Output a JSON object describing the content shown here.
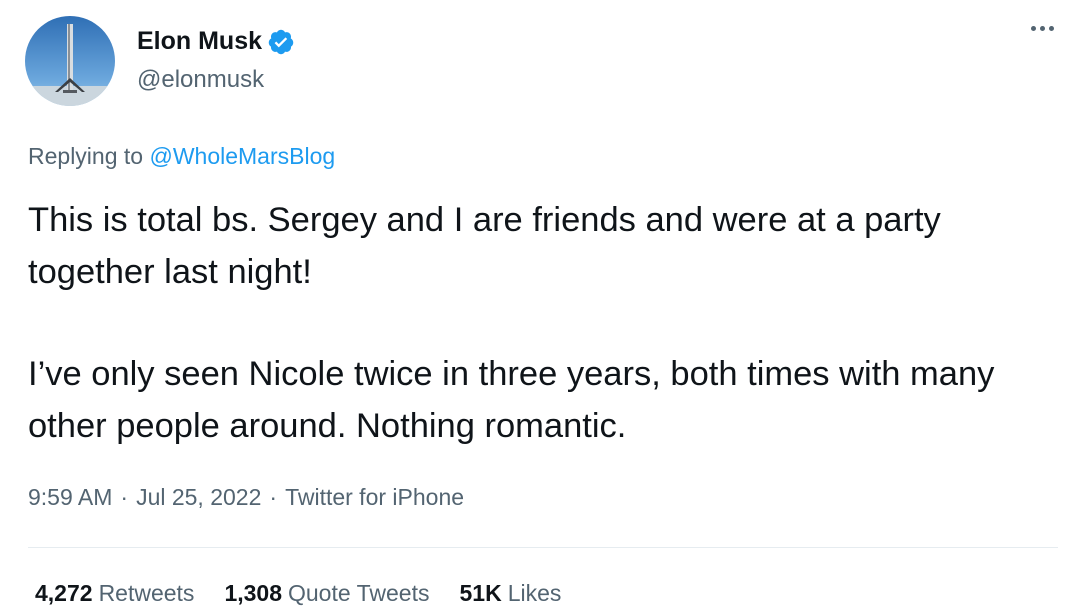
{
  "author": {
    "name": "Elon Musk",
    "handle": "@elonmusk"
  },
  "reply": {
    "prefix": "Replying to",
    "to": "@WholeMarsBlog"
  },
  "tweet": {
    "paragraphs": [
      "This is total bs. Sergey and I are friends and were at a party together last night!",
      "I’ve only seen Nicole twice in three years, both times with many other people around. Nothing romantic."
    ]
  },
  "meta": {
    "time": "9:59 AM",
    "date": "Jul 25, 2022",
    "source": "Twitter for iPhone",
    "separator": "·"
  },
  "stats": {
    "retweets_count": "4,272",
    "retweets_label": "Retweets",
    "quotes_count": "1,308",
    "quotes_label": "Quote Tweets",
    "likes_count": "51K",
    "likes_label": "Likes"
  },
  "colors": {
    "accent": "#1d9bf0",
    "text": "#0f1419",
    "secondary": "#536471"
  },
  "icons": {
    "verified": "verified-badge-icon",
    "more": "more-dots-icon"
  }
}
